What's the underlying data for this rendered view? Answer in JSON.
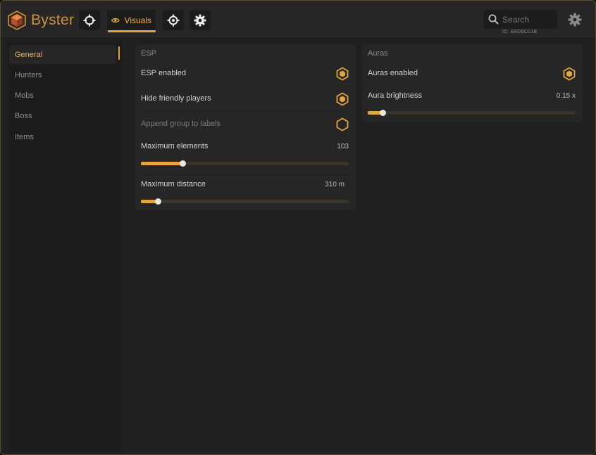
{
  "brand": {
    "name": "Byster"
  },
  "nav": {
    "visuals_label": "Visuals"
  },
  "search": {
    "placeholder": "Search"
  },
  "client_id": "ID: E8D5C01B",
  "sidebar": {
    "items": [
      {
        "label": "General",
        "active": true
      },
      {
        "label": "Hunters"
      },
      {
        "label": "Mobs"
      },
      {
        "label": "Boss"
      },
      {
        "label": "Items"
      }
    ]
  },
  "esp": {
    "title": "ESP",
    "esp_enabled": {
      "label": "ESP enabled",
      "on": true
    },
    "hide_friendly": {
      "label": "Hide friendly players",
      "on": true
    },
    "append_group": {
      "label": "Append group to labels",
      "on": false
    },
    "max_elements": {
      "label": "Maximum elements",
      "value": "103",
      "fraction": 0.2
    },
    "max_distance": {
      "label": "Maximum distance",
      "value": "310 m",
      "fraction": 0.08
    }
  },
  "auras": {
    "title": "Auras",
    "auras_enabled": {
      "label": "Auras enabled",
      "on": true
    },
    "aura_brightness": {
      "label": "Aura brightness",
      "value": "0.15 x",
      "fraction": 0.07
    }
  },
  "colors": {
    "accent": "#e3a53e",
    "window_bg": "#202020",
    "panel_bg": "#262626"
  },
  "icons": [
    "byster-logo-icon",
    "crosshair-icon",
    "eye-icon",
    "target-icon",
    "gear-icon",
    "search-icon",
    "hexagon-toggle-icon"
  ]
}
